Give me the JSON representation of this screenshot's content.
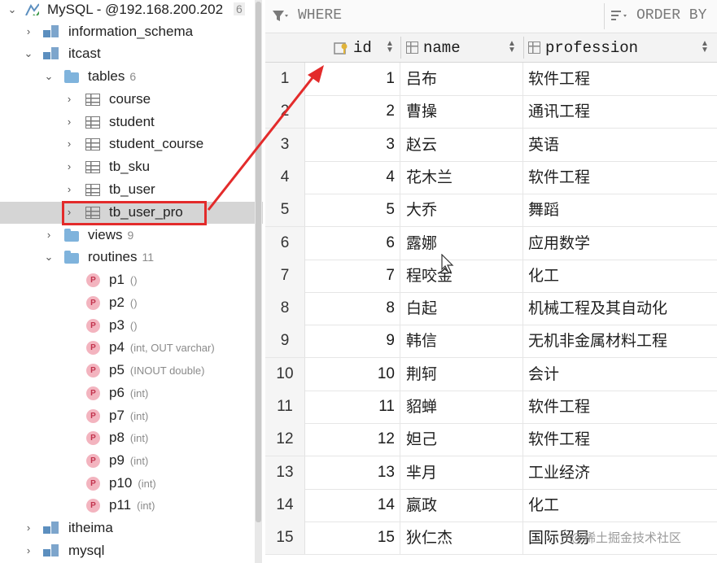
{
  "tree": {
    "connection": {
      "label": "MySQL - @192.168.200.202",
      "badge": "6"
    },
    "schemas": {
      "information_schema": "information_schema",
      "itcast": "itcast",
      "itheima": "itheima",
      "mysql": "mysql"
    },
    "tables": {
      "label": "tables",
      "count": "6",
      "items": [
        "course",
        "student",
        "student_course",
        "tb_sku",
        "tb_user",
        "tb_user_pro"
      ]
    },
    "views": {
      "label": "views",
      "count": "9"
    },
    "routines": {
      "label": "routines",
      "count": "11",
      "items": [
        {
          "name": "p1",
          "sig": "()"
        },
        {
          "name": "p2",
          "sig": "()"
        },
        {
          "name": "p3",
          "sig": "()"
        },
        {
          "name": "p4",
          "sig": "(int, OUT varchar)"
        },
        {
          "name": "p5",
          "sig": "(INOUT double)"
        },
        {
          "name": "p6",
          "sig": "(int)"
        },
        {
          "name": "p7",
          "sig": "(int)"
        },
        {
          "name": "p8",
          "sig": "(int)"
        },
        {
          "name": "p9",
          "sig": "(int)"
        },
        {
          "name": "p10",
          "sig": "(int)"
        },
        {
          "name": "p11",
          "sig": "(int)"
        }
      ]
    },
    "proc_badge": "P"
  },
  "filter": {
    "where": "WHERE",
    "order_by": "ORDER BY"
  },
  "columns": {
    "id": "id",
    "name": "name",
    "profession": "profession"
  },
  "rows": [
    {
      "n": "1",
      "id": "1",
      "name": "吕布",
      "profession": "软件工程"
    },
    {
      "n": "2",
      "id": "2",
      "name": "曹操",
      "profession": "通讯工程"
    },
    {
      "n": "3",
      "id": "3",
      "name": "赵云",
      "profession": "英语"
    },
    {
      "n": "4",
      "id": "4",
      "name": "花木兰",
      "profession": "软件工程"
    },
    {
      "n": "5",
      "id": "5",
      "name": "大乔",
      "profession": "舞蹈"
    },
    {
      "n": "6",
      "id": "6",
      "name": "露娜",
      "profession": "应用数学"
    },
    {
      "n": "7",
      "id": "7",
      "name": "程咬金",
      "profession": "化工"
    },
    {
      "n": "8",
      "id": "8",
      "name": "白起",
      "profession": "机械工程及其自动化"
    },
    {
      "n": "9",
      "id": "9",
      "name": "韩信",
      "profession": "无机非金属材料工程"
    },
    {
      "n": "10",
      "id": "10",
      "name": "荆轲",
      "profession": "会计"
    },
    {
      "n": "11",
      "id": "11",
      "name": "貂蝉",
      "profession": "软件工程"
    },
    {
      "n": "12",
      "id": "12",
      "name": "妲己",
      "profession": "软件工程"
    },
    {
      "n": "13",
      "id": "13",
      "name": "芈月",
      "profession": "工业经济"
    },
    {
      "n": "14",
      "id": "14",
      "name": "嬴政",
      "profession": "化工"
    },
    {
      "n": "15",
      "id": "15",
      "name": "狄仁杰",
      "profession": "国际贸易"
    }
  ],
  "watermark": "@稀土掘金技术社区",
  "colors": {
    "annotation": "#e32b2b",
    "selection": "#d5d5d5",
    "folder": "#7fb3dc",
    "proc_badge": "#f3b4bf"
  }
}
